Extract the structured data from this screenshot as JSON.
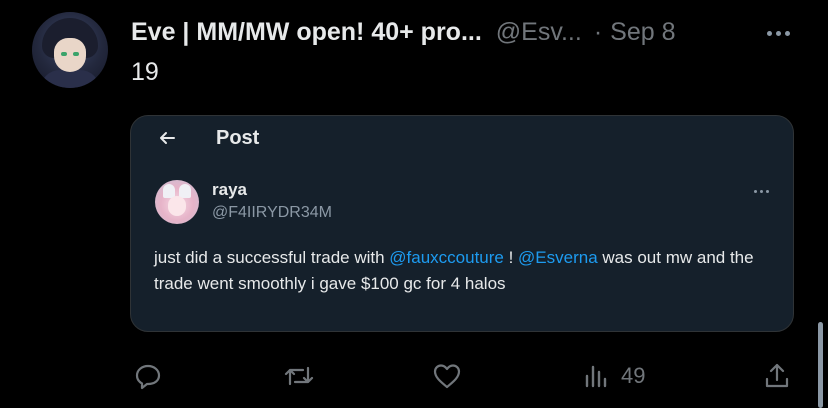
{
  "tweet": {
    "author": {
      "display_name": "Eve | MM/MW open! 40+ pro...",
      "handle": "@Esv...",
      "separator": "·",
      "date": "Sep 8"
    },
    "text": "19",
    "quote": {
      "header_title": "Post",
      "author_name": "raya",
      "author_handle": "@F4IIRYDR34M",
      "body": {
        "part1": "just did a successful trade with ",
        "mention1": "@fauxccouture",
        "part2": " ! ",
        "mention2": "@Esverna",
        "part3": " was out mw and the trade went smoothly i gave $100 gc for 4 halos"
      }
    },
    "actions": {
      "views_count": "49"
    }
  },
  "colors": {
    "background": "#000000",
    "text_primary": "#e7e9ea",
    "text_secondary": "#71767b",
    "accent": "#1d9bf0",
    "quote_background": "#15202b"
  },
  "icons": {
    "more": "more-horizontal-icon",
    "back": "arrow-left-icon",
    "reply": "reply-bubble-icon",
    "repost": "repost-arrows-icon",
    "like": "heart-icon",
    "views": "bar-chart-icon",
    "share": "share-upload-icon"
  }
}
